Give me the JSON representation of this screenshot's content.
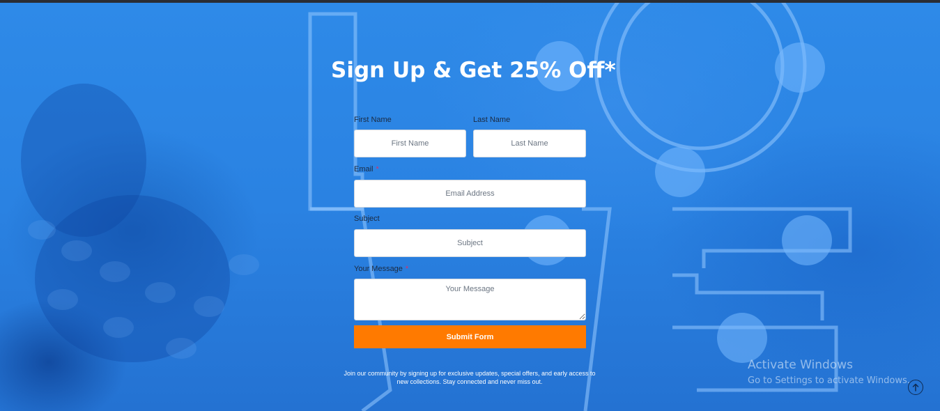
{
  "form": {
    "title": "Sign Up & Get 25% Off*",
    "first_name": {
      "label": "First Name",
      "placeholder": "First Name"
    },
    "last_name": {
      "label": "Last Name",
      "placeholder": "Last Name"
    },
    "email": {
      "label": "Email",
      "required_mark": "*",
      "placeholder": "Email Address"
    },
    "subject": {
      "label": "Subject",
      "placeholder": "Subject"
    },
    "message": {
      "label": "Your Message",
      "required_mark": "*",
      "placeholder": "Your Message"
    },
    "submit_label": "Submit Form",
    "note_line1": "Join our community by signing up for exclusive updates, special offers, and early access to",
    "note_line2": "new collections. Stay connected and never miss out."
  },
  "os_watermark": {
    "title": "Activate Windows",
    "subtitle": "Go to Settings to activate Windows."
  },
  "icons": {
    "scroll_top": "arrow-up-circle-icon"
  },
  "colors": {
    "background_tint": "#2b86e6",
    "submit_button": "#ff7a00",
    "required_mark": "#d6336c",
    "headline": "#ffffff"
  }
}
